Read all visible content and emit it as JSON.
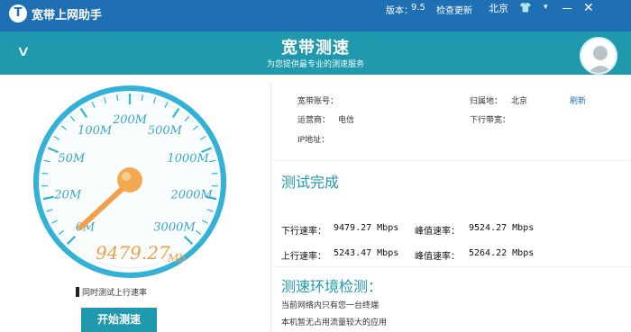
{
  "titlebar": {
    "app_title": "宽带上网助手",
    "logo_glyph": "T",
    "version_label": "版本：",
    "version": "9.5",
    "check_update": "检查更新",
    "city": "北京",
    "shirt_glyph": "👕",
    "dropdown_glyph": "▾",
    "minimize_glyph": "－",
    "close_glyph": "✕"
  },
  "header": {
    "collapse_glyph": "∨",
    "title": "宽带测速",
    "subtitle": "为您提供最专业的测速服务"
  },
  "gauge": {
    "ticks": [
      "0M",
      "20M",
      "50M",
      "100M",
      "200M",
      "500M",
      "1000M",
      "2000M",
      "3000M"
    ],
    "reading": "9479.27",
    "reading_unit": "Mb",
    "colors": {
      "ring": "#33b1d6",
      "tick_label": "#3aa6c8",
      "needle": "#f0a048",
      "reading": "#f0a048"
    }
  },
  "controls": {
    "concurrent_label": "同时测试上行速率",
    "start_button": "开始测速"
  },
  "info": {
    "account_label": "宽带账号：",
    "account_value": "",
    "region_label": "归属地：",
    "region_value": "北京",
    "refresh": "刷新",
    "isp_label": "运营商：",
    "isp_value": "电信",
    "downlink_label": "下行带宽：",
    "downlink_value": "",
    "ip_label": "IP地址：",
    "ip_value": ""
  },
  "result": {
    "title": "测试完成",
    "down_label": "下行速率：",
    "down_value": "9479.27 Mbps",
    "down_peak_label": "峰值速率：",
    "down_peak_value": "9524.27 Mbps",
    "up_label": "上行速率：",
    "up_value": "5243.47 Mbps",
    "up_peak_label": "峰值速率：",
    "up_peak_value": "5264.22 Mbps"
  },
  "environment": {
    "title": "测速环境检测：",
    "line1": "当前网络内只有您一台终端",
    "line2": "本机暂无占用流量较大的应用"
  },
  "theme": {
    "titlebar": "#1f6fb4",
    "header": "#1f99ad",
    "accent": "#1f99ad"
  }
}
